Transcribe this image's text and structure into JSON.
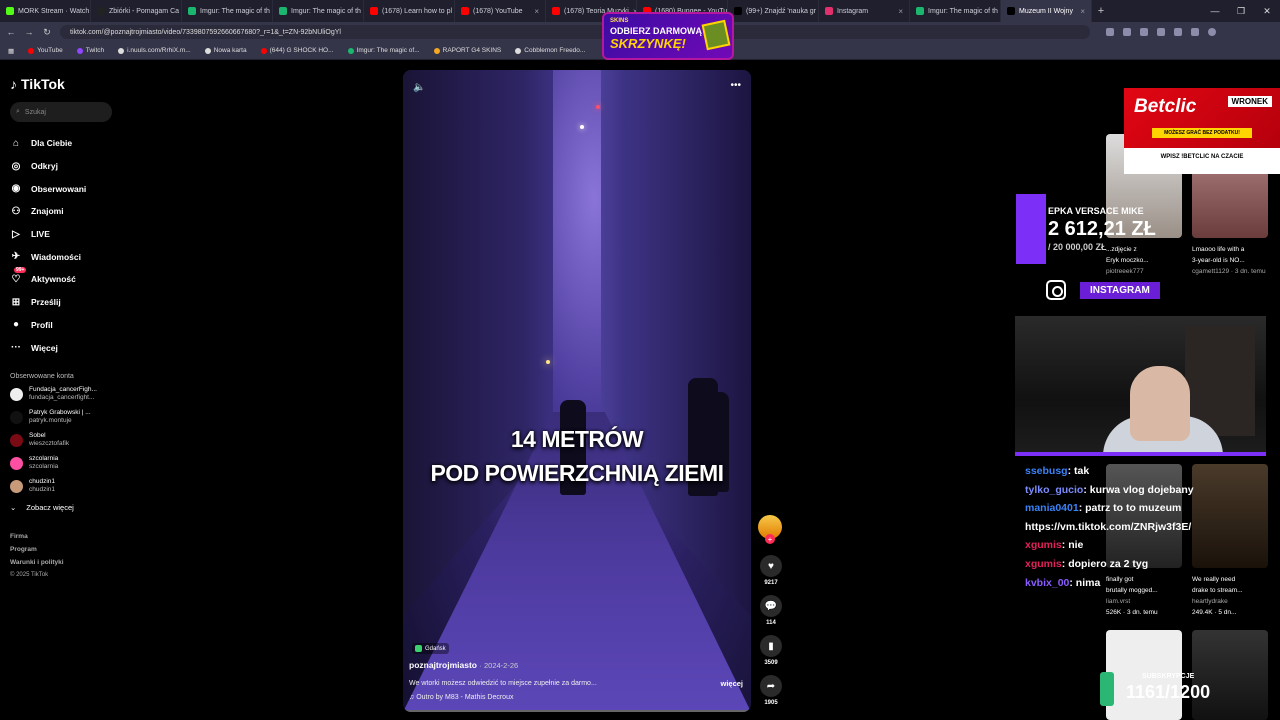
{
  "browser": {
    "tabs": [
      {
        "label": "MORK Stream · Watch",
        "color": "#53fc18"
      },
      {
        "label": "Zbiórki - Pomagam Ca",
        "color": "#222"
      },
      {
        "label": "Imgur: The magic of th",
        "color": "#1bb76e"
      },
      {
        "label": "Imgur: The magic of th",
        "color": "#1bb76e"
      },
      {
        "label": "(1678) Learn how to pl",
        "color": "#ff0000"
      },
      {
        "label": "(1678) YouTube",
        "color": "#ff0000"
      },
      {
        "label": "(1678) Teoria Muzyki",
        "color": "#ff0000"
      },
      {
        "label": "(1680) Bungee - YouTu",
        "color": "#ff0000"
      },
      {
        "label": "(99+) Znajdź 'nauka gr",
        "color": "#000"
      },
      {
        "label": "Instagram",
        "color": "#e1306c"
      },
      {
        "label": "Imgur: The magic of th",
        "color": "#1bb76e"
      },
      {
        "label": "Muzeum II Wojny",
        "color": "#000"
      }
    ],
    "url": "tiktok.com/@poznajtrojmiasto/video/7339807592660667680?_r=1&_t=ZN-92bNUliOgYl",
    "bookmarks": [
      {
        "label": "YouTube",
        "color": "#ff0000"
      },
      {
        "label": "Twitch",
        "color": "#9146ff"
      },
      {
        "label": "i.nuuls.com/RrhiX.m...",
        "color": "#ddd"
      },
      {
        "label": "Nowa karta",
        "color": "#ddd"
      },
      {
        "label": "(644) G SHOCK HO...",
        "color": "#ff0000"
      },
      {
        "label": "Imgur: The magic of...",
        "color": "#1bb76e"
      },
      {
        "label": "RAPORT G4 SKINS",
        "color": "#f5a623"
      },
      {
        "label": "Cobblemon Freedo...",
        "color": "#ddd"
      }
    ]
  },
  "promo": {
    "brand": "SKINS",
    "line1": "ODBIERZ DARMOWĄ",
    "line2": "SKRZYNKĘ!"
  },
  "sidebar": {
    "logo": "TikTok",
    "search_placeholder": "Szukaj",
    "nav": [
      {
        "label": "Dla Ciebie",
        "icon": "home-icon"
      },
      {
        "label": "Odkryj",
        "icon": "compass-icon"
      },
      {
        "label": "Obserwowani",
        "icon": "following-icon"
      },
      {
        "label": "Znajomi",
        "icon": "friends-icon"
      },
      {
        "label": "LIVE",
        "icon": "live-icon"
      },
      {
        "label": "Wiadomości",
        "icon": "messages-icon"
      },
      {
        "label": "Aktywność",
        "icon": "activity-icon",
        "badge": "99+"
      },
      {
        "label": "Prześlij",
        "icon": "upload-icon"
      },
      {
        "label": "Profil",
        "icon": "profile-icon"
      },
      {
        "label": "Więcej",
        "icon": "more-icon"
      }
    ],
    "following_title": "Obserwowane konta",
    "following": [
      {
        "name": "Fundacja_cancerFigh...",
        "handle": "fundacja_cancerfight...",
        "color": "#eee"
      },
      {
        "name": "Patryk Grabowski | ...",
        "handle": "patryk.montuje",
        "color": "#111"
      },
      {
        "name": "Sobel",
        "handle": "wieszcztofafik",
        "color": "#7a0a14"
      },
      {
        "name": "szcolarnia",
        "handle": "szcolarnia",
        "color": "#ff4fa3"
      },
      {
        "name": "chudzin1",
        "handle": "chudzin1",
        "color": "#c79b7a"
      }
    ],
    "see_more": "Zobacz więcej",
    "footer": [
      "Firma",
      "Program",
      "Warunki i polityki"
    ],
    "copyright": "© 2025 TikTok"
  },
  "video": {
    "caption_line1": "14 METRÓW",
    "caption_line2": "POD POWIERZCHNIĄ ZIEMI",
    "location": "Gdańsk",
    "author": "poznajtrojmiasto",
    "date": "· 2024-2-26",
    "description": "We wtorki możesz odwiedzić to miejsce zupełnie za darmo...",
    "more": "więcej",
    "music": "Outro by M83 - Mathis Decroux"
  },
  "actions": {
    "likes": "9217",
    "comments": "114",
    "saves": "3509",
    "shares": "1905"
  },
  "right": {
    "thumbs": [
      {
        "title": "...zdjęcie z",
        "title2": "Eryk moczko...",
        "user": "piotreeek777"
      },
      {
        "title": "Lmaooo life with a",
        "title2": "3-year-old is NO...",
        "user": "cgamett1129 · 3 dn. temu"
      },
      {
        "title": "finally got",
        "title2": "brutally mogged...",
        "user": "liam.vrst",
        "stats": "526K · 3 dn. temu"
      },
      {
        "title": "We really need",
        "title2": "drake to stream...",
        "user": "heartlydrake",
        "stats": "249.4K · 5 dn..."
      }
    ],
    "betclic": {
      "logo": "Betclic",
      "kod": "WRONEK",
      "bar": "MOŻESZ GRAĆ BEZ PODATKU!",
      "wpisz": "WPISZ !BETCLIC NA CZACIE"
    },
    "donation": {
      "title": "EPKA VERSACE MIKE",
      "amount": "2 612,21 ZŁ",
      "goal": "/ 20 000,00 ZŁ"
    },
    "instagram": "INSTAGRAM",
    "chat": [
      {
        "user": "ssebusg",
        "color": "#3b82f6",
        "msg": "tak"
      },
      {
        "user": "tylko_gucio",
        "color": "#7c8cff",
        "msg": "kurwa vlog dojebany",
        "hl": "kurwa"
      },
      {
        "user": "mania0401",
        "color": "#3b82f6",
        "msg": "patrz to to muzeum"
      },
      {
        "user": "",
        "color": "#fff",
        "msg": "https://vm.tiktok.com/ZNRjw3f3E/"
      },
      {
        "user": "xgumis",
        "color": "#e0225b",
        "msg": "nie"
      },
      {
        "user": "xgumis",
        "color": "#e0225b",
        "msg": "dopiero za 2 tyg"
      },
      {
        "user": "kvbix_00",
        "color": "#8a5cff",
        "msg": "nima"
      }
    ],
    "subs_label": "SUBSKRYPCJE",
    "subs_value": "1161/1200"
  }
}
